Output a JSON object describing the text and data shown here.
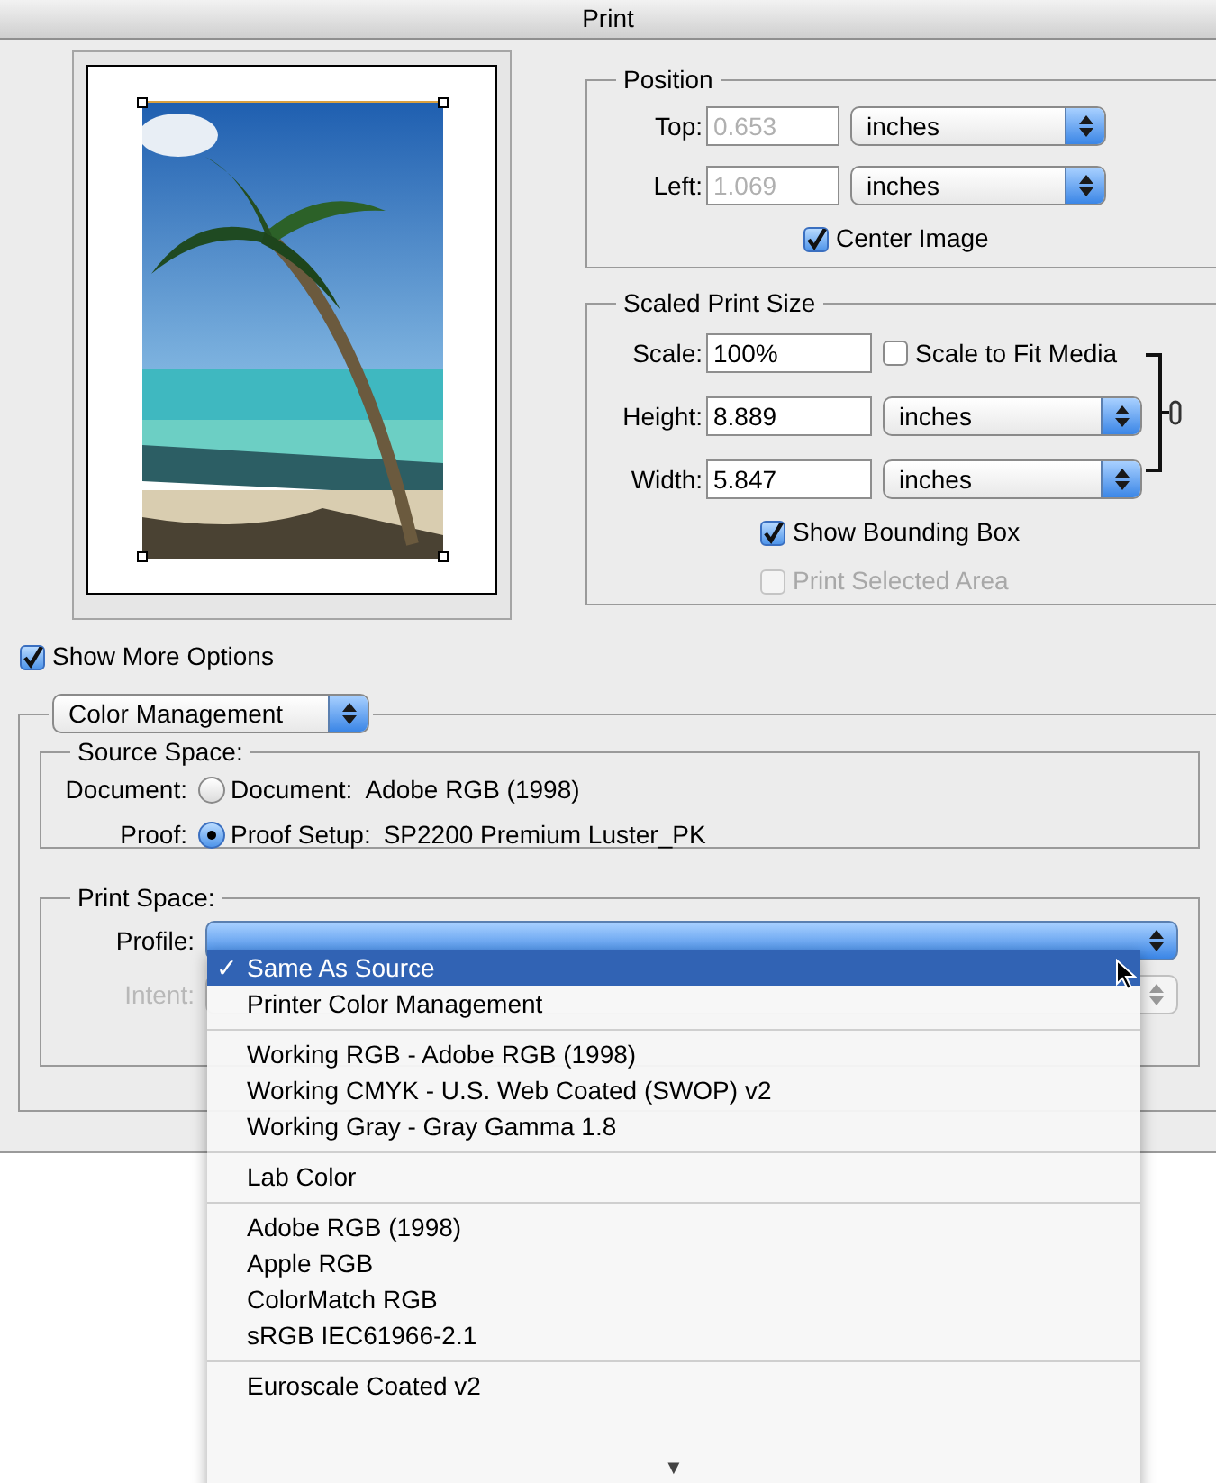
{
  "window": {
    "title": "Print"
  },
  "position": {
    "title": "Position",
    "fields": [
      {
        "label": "Top:",
        "value": "0.653",
        "unit": "inches",
        "disabled": true
      },
      {
        "label": "Left:",
        "value": "1.069",
        "unit": "inches",
        "disabled": true
      }
    ],
    "center_image": {
      "label": "Center Image",
      "checked": true
    }
  },
  "scaled_print_size": {
    "title": "Scaled Print Size",
    "scale": {
      "label": "Scale:",
      "value": "100%"
    },
    "scale_to_fit": {
      "label": "Scale to Fit Media",
      "checked": false
    },
    "fields": [
      {
        "label": "Height:",
        "value": "8.889",
        "unit": "inches",
        "disabled": false
      },
      {
        "label": "Width:",
        "value": "5.847",
        "unit": "inches",
        "disabled": false
      }
    ],
    "options": [
      {
        "label": "Show Bounding Box",
        "checked": true,
        "disabled": false
      },
      {
        "label": "Print Selected Area",
        "checked": false,
        "disabled": true
      }
    ]
  },
  "show_more_options": {
    "label": "Show More Options",
    "checked": true
  },
  "section_popup": "Color Management",
  "source_space": {
    "title": "Source Space:",
    "options": [
      {
        "label": "Document:",
        "option": "Document:",
        "value": "Adobe RGB (1998)",
        "selected": false
      },
      {
        "label": "Proof:",
        "option": "Proof Setup:",
        "value": "SP2200 Premium Luster_PK",
        "selected": true
      }
    ]
  },
  "print_space": {
    "title": "Print Space:",
    "profile_label": "Profile:",
    "intent_label": "Intent:"
  },
  "profile_menu": {
    "check_mark": "✓",
    "groups": [
      [
        {
          "label": "Same As Source",
          "selected": true
        },
        {
          "label": "Printer Color Management",
          "selected": false
        }
      ],
      [
        {
          "label": "Working RGB - Adobe RGB (1998)",
          "selected": false
        },
        {
          "label": "Working CMYK - U.S. Web Coated (SWOP) v2",
          "selected": false
        },
        {
          "label": "Working Gray - Gray Gamma 1.8",
          "selected": false
        }
      ],
      [
        {
          "label": "Lab Color",
          "selected": false
        }
      ],
      [
        {
          "label": "Adobe RGB (1998)",
          "selected": false
        },
        {
          "label": "Apple RGB",
          "selected": false
        },
        {
          "label": "ColorMatch RGB",
          "selected": false
        },
        {
          "label": "sRGB IEC61966-2.1",
          "selected": false
        }
      ],
      [
        {
          "label": "Euroscale Coated v2",
          "selected": false
        }
      ]
    ],
    "scroll_arrow": "▼"
  }
}
